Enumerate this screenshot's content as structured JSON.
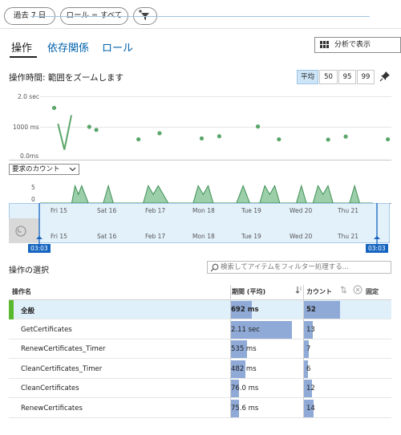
{
  "filters": {
    "time": "過去 7 日",
    "role": "ロール = すべて"
  },
  "tabs": [
    {
      "label": "操作"
    },
    {
      "label": "依存関係"
    },
    {
      "label": "ロール"
    }
  ],
  "analyze_label": "分析で表示",
  "duration_title": "操作時間: 範囲をズームします",
  "percentiles": [
    "平均",
    "50",
    "95",
    "99"
  ],
  "chart_y_labels": [
    "2.0 sec",
    "1000 ms",
    "0.0ms"
  ],
  "count_dropdown": "要求のカウント",
  "count_y_labels": [
    "5",
    "0"
  ],
  "x_labels": [
    "Fri 15",
    "Sat 16",
    "Feb 17",
    "Mon 18",
    "Tue 19",
    "Wed 20",
    "Thu 21"
  ],
  "time_badges": {
    "start": "03:03",
    "end": "03:03"
  },
  "op_section_title": "操作の選択",
  "search_placeholder": "検索してアイテムをフィルター処理する...",
  "table": {
    "headers": {
      "name": "操作名",
      "duration": "期間 (平均)",
      "count": "カウント",
      "pin": "固定"
    },
    "rows": [
      {
        "name": "全般",
        "duration": "692 ms",
        "count": "52",
        "dur_frac": 0.3,
        "cnt_frac": 0.87
      },
      {
        "name": "GetCertificates",
        "duration": "2.11 sec",
        "count": "13",
        "dur_frac": 0.86,
        "cnt_frac": 0.22
      },
      {
        "name": "RenewCertificates_Timer",
        "duration": "535 ms",
        "count": "7",
        "dur_frac": 0.23,
        "cnt_frac": 0.12
      },
      {
        "name": "CleanCertificates_Timer",
        "duration": "482 ms",
        "count": "6",
        "dur_frac": 0.21,
        "cnt_frac": 0.1
      },
      {
        "name": "CleanCertificates",
        "duration": "76.0 ms",
        "count": "12",
        "dur_frac": 0.12,
        "cnt_frac": 0.2
      },
      {
        "name": "RenewCertificates",
        "duration": "75.6 ms",
        "count": "14",
        "dur_frac": 0.12,
        "cnt_frac": 0.23
      }
    ]
  },
  "colors": {
    "accent": "#0062ad",
    "green": "#5aa66a",
    "bar": "#8faad6",
    "selected": "#e0f0fb",
    "badge": "#1565c0"
  },
  "chart_data": [
    {
      "type": "scatter",
      "y_unit": "ms",
      "ylim": [
        0,
        2000
      ],
      "points": [
        {
          "x": 0.02,
          "y": 1620
        },
        {
          "x": 0.07,
          "y": 1000
        },
        {
          "x": 0.08,
          "y": 900
        },
        {
          "x": 0.14,
          "y": 590
        },
        {
          "x": 0.17,
          "y": 790
        },
        {
          "x": 0.23,
          "y": 620
        },
        {
          "x": 0.255,
          "y": 690
        },
        {
          "x": 0.31,
          "y": 1010
        },
        {
          "x": 0.34,
          "y": 590
        },
        {
          "x": 0.41,
          "y": 580
        },
        {
          "x": 0.435,
          "y": 680
        },
        {
          "x": 0.495,
          "y": 590
        }
      ],
      "spike": {
        "x": [
          0.03,
          0.04
        ],
        "y": [
          1100,
          250,
          1380
        ]
      }
    },
    {
      "type": "area",
      "ylim": [
        0,
        5
      ],
      "x": [
        0.0,
        0.095,
        0.105,
        0.115,
        0.125,
        0.135,
        0.145,
        0.19,
        0.205,
        0.22,
        0.31,
        0.325,
        0.34,
        0.355,
        0.37,
        0.385,
        0.46,
        0.475,
        0.49,
        0.505,
        0.52,
        0.59,
        0.61,
        0.63,
        0.66,
        0.675,
        0.69,
        0.705,
        0.72,
        0.77,
        0.785,
        0.8,
        0.82,
        0.835,
        0.85,
        0.865,
        0.88,
        0.93,
        0.945,
        0.96,
        1.0
      ],
      "values": [
        0,
        0,
        4,
        2,
        4,
        2,
        0,
        0,
        4,
        0,
        0,
        4,
        2,
        4,
        2,
        0,
        0,
        4,
        2,
        4,
        0,
        0,
        4,
        0,
        0,
        4,
        2,
        4,
        0,
        0,
        4,
        0,
        0,
        4,
        2,
        4,
        0,
        0,
        4,
        0,
        0
      ]
    }
  ]
}
